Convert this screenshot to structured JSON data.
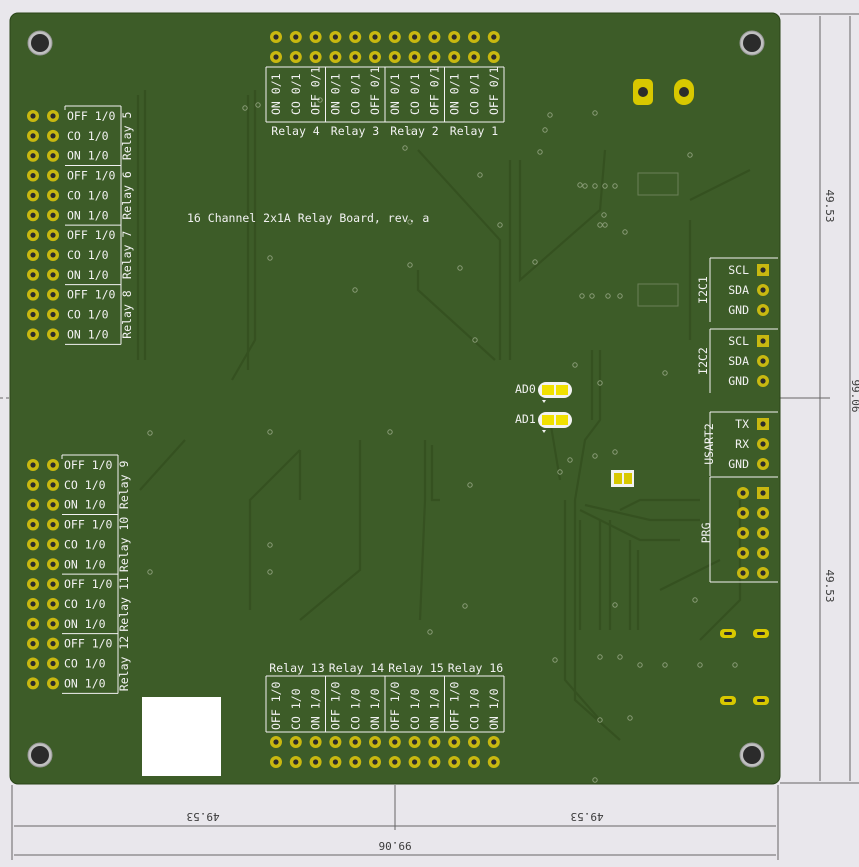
{
  "board_title": "16 Channel 2x1A Relay Board, rev. a",
  "colors": {
    "board": "#3d5c28",
    "pad": "#c8b810",
    "silkscreen": "#f2f2f2",
    "background": "#e9e7ec",
    "dimension": "#555555"
  },
  "dimensions": {
    "width_half_left": "49.53",
    "width_half_right": "49.53",
    "width_total": "99.06",
    "height_half_top": "49.53",
    "height_half_bottom": "49.53",
    "height_total": "99.06"
  },
  "relays_top": [
    {
      "name": "Relay 4",
      "pins": [
        "ON 0/1",
        "CO 0/1",
        "OFF 0/1"
      ]
    },
    {
      "name": "Relay 3",
      "pins": [
        "ON 0/1",
        "CO 0/1",
        "OFF 0/1"
      ]
    },
    {
      "name": "Relay 2",
      "pins": [
        "ON 0/1",
        "CO 0/1",
        "OFF 0/1"
      ]
    },
    {
      "name": "Relay 1",
      "pins": [
        "ON 0/1",
        "CO 0/1",
        "OFF 0/1"
      ]
    }
  ],
  "relays_left_upper": [
    {
      "name": "Relay 5",
      "pins": [
        "OFF 1/0",
        "CO 1/0",
        "ON 1/0"
      ]
    },
    {
      "name": "Relay 6",
      "pins": [
        "OFF 1/0",
        "CO 1/0",
        "ON 1/0"
      ]
    },
    {
      "name": "Relay 7",
      "pins": [
        "OFF 1/0",
        "CO 1/0",
        "ON 1/0"
      ]
    },
    {
      "name": "Relay 8",
      "pins": [
        "OFF 1/0",
        "CO 1/0",
        "ON 1/0"
      ]
    }
  ],
  "relays_left_lower": [
    {
      "name": "Relay 9",
      "pins": [
        "OFF 1/0",
        "CO 1/0",
        "ON 1/0"
      ]
    },
    {
      "name": "Relay 10",
      "pins": [
        "OFF 1/0",
        "CO 1/0",
        "ON 1/0"
      ]
    },
    {
      "name": "Relay 11",
      "pins": [
        "OFF 1/0",
        "CO 1/0",
        "ON 1/0"
      ]
    },
    {
      "name": "Relay 12",
      "pins": [
        "OFF 1/0",
        "CO 1/0",
        "ON 1/0"
      ]
    }
  ],
  "relays_bottom": [
    {
      "name": "Relay 13",
      "pins": [
        "OFF 1/0",
        "CO 1/0",
        "ON 1/0"
      ]
    },
    {
      "name": "Relay 14",
      "pins": [
        "OFF 1/0",
        "CO 1/0",
        "ON 1/0"
      ]
    },
    {
      "name": "Relay 15",
      "pins": [
        "OFF 1/0",
        "CO 1/0",
        "ON 1/0"
      ]
    },
    {
      "name": "Relay 16",
      "pins": [
        "OFF 1/0",
        "CO 1/0",
        "ON 1/0"
      ]
    }
  ],
  "connectors": [
    {
      "name": "I2C1",
      "pins": [
        "SCL",
        "SDA",
        "GND"
      ]
    },
    {
      "name": "I2C2",
      "pins": [
        "SCL",
        "SDA",
        "GND"
      ]
    },
    {
      "name": "USART2",
      "pins": [
        "TX",
        "RX",
        "GND"
      ]
    },
    {
      "name": "PRG",
      "pins": []
    }
  ],
  "jumpers": [
    {
      "label": "AD0"
    },
    {
      "label": "AD1"
    }
  ]
}
